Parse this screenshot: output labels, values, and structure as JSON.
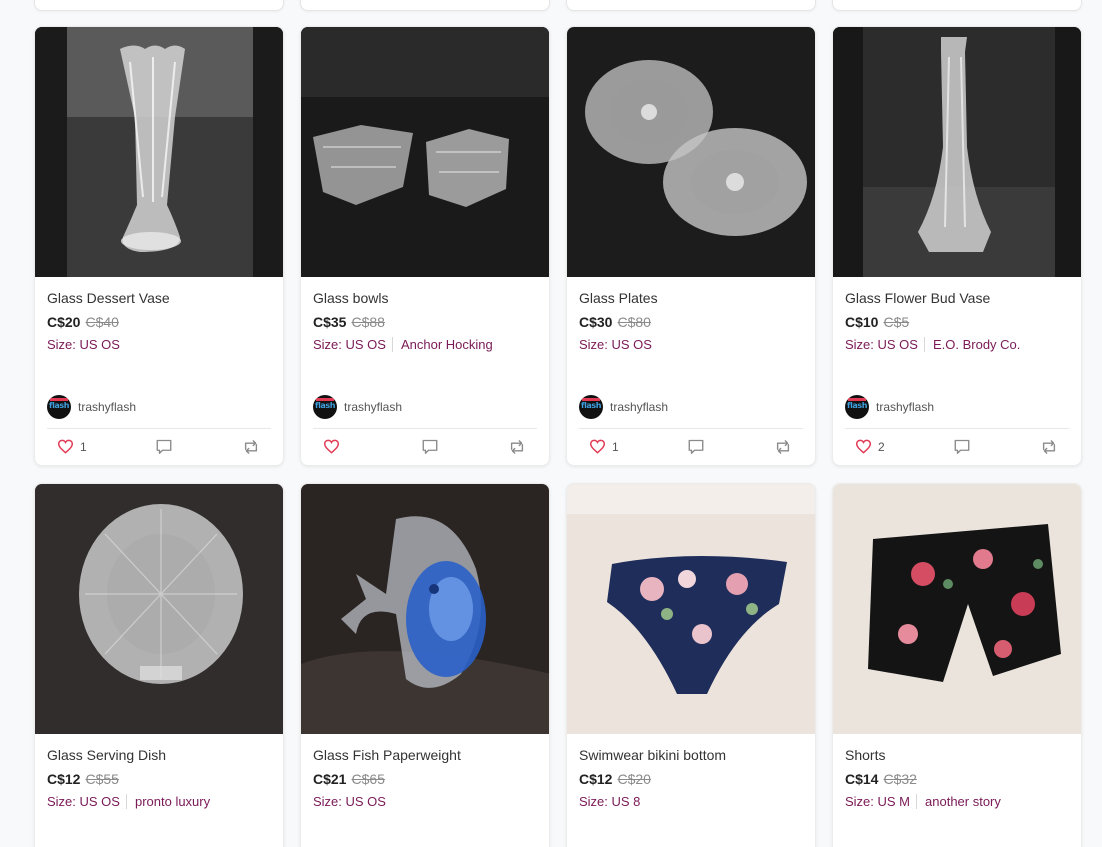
{
  "colors": {
    "accent": "#7a1a56",
    "heart": "#e03a54"
  },
  "listings": [
    {
      "title": "Glass Dessert Vase",
      "price": "C$20",
      "original_price": "C$40",
      "size": "Size: US OS",
      "brand": "",
      "seller": "trashyflash",
      "likes": "1",
      "image": "glass-dessert-vase"
    },
    {
      "title": "Glass bowls",
      "price": "C$35",
      "original_price": "C$88",
      "size": "Size: US OS",
      "brand": "Anchor Hocking",
      "seller": "trashyflash",
      "likes": "",
      "image": "glass-bowls"
    },
    {
      "title": "Glass Plates",
      "price": "C$30",
      "original_price": "C$80",
      "size": "Size: US OS",
      "brand": "",
      "seller": "trashyflash",
      "likes": "1",
      "image": "glass-plates"
    },
    {
      "title": "Glass Flower Bud Vase",
      "price": "C$10",
      "original_price": "C$5",
      "size": "Size: US OS",
      "brand": "E.O. Brody Co.",
      "seller": "trashyflash",
      "likes": "2",
      "image": "glass-bud-vase"
    },
    {
      "title": "Glass Serving Dish",
      "price": "C$12",
      "original_price": "C$55",
      "size": "Size: US OS",
      "brand": "pronto luxury",
      "image": "glass-serving-dish"
    },
    {
      "title": "Glass Fish Paperweight",
      "price": "C$21",
      "original_price": "C$65",
      "size": "Size: US OS",
      "brand": "",
      "image": "glass-fish-paperweight"
    },
    {
      "title": "Swimwear bikini bottom",
      "price": "C$12",
      "original_price": "C$20",
      "size": "Size: US 8",
      "brand": "",
      "image": "bikini-bottom"
    },
    {
      "title": "Shorts",
      "price": "C$14",
      "original_price": "C$32",
      "size": "Size: US M",
      "brand": "another story",
      "image": "floral-shorts"
    }
  ],
  "avatar_text": "flash",
  "icons": {
    "like": "heart-icon",
    "comment": "comment-icon",
    "share": "share-icon"
  }
}
